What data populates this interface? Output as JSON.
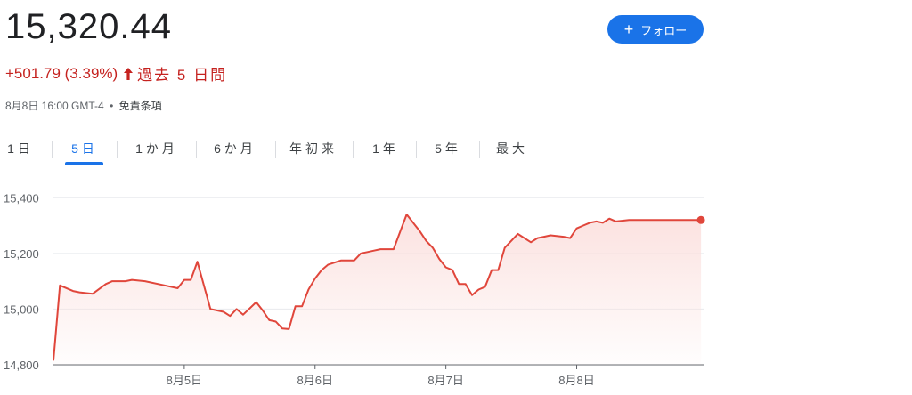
{
  "quote": {
    "price": "15,320.44",
    "change": "+501.79 (3.39%)",
    "period": "過去 5 日間",
    "timestamp": "8月8日 16:00 GMT-4",
    "separator": "•",
    "disclaimer": "免責条項"
  },
  "follow_button": {
    "icon": "plus-icon",
    "label": "フォロー"
  },
  "tabs": [
    {
      "label": "1日",
      "active": false
    },
    {
      "label": "5日",
      "active": true
    },
    {
      "label": "1か月",
      "active": false
    },
    {
      "label": "6か月",
      "active": false
    },
    {
      "label": "年初来",
      "active": false
    },
    {
      "label": "1年",
      "active": false
    },
    {
      "label": "5年",
      "active": false
    },
    {
      "label": "最大",
      "active": false
    }
  ],
  "colors": {
    "line": "#e0463b",
    "fill": "#fbe0de",
    "accent": "#1a73e8",
    "negative": "#c5221f"
  },
  "chart_data": {
    "type": "area",
    "ylim": [
      14800,
      15420
    ],
    "yticks": [
      14800,
      15000,
      15200,
      15400
    ],
    "ytick_labels": [
      "14,800",
      "15,000",
      "15,200",
      "15,400"
    ],
    "xlim": [
      0,
      4.97
    ],
    "xticks": [
      1,
      2,
      3,
      4
    ],
    "xtick_labels": [
      "8月5日",
      "8月6日",
      "8月7日",
      "8月8日"
    ],
    "grid": true,
    "series": [
      {
        "x": [
          0,
          0.05,
          0.15,
          0.2,
          0.3,
          0.4,
          0.45,
          0.55,
          0.6,
          0.7,
          0.85,
          0.95,
          1.0,
          1.05,
          1.1,
          1.2,
          1.3,
          1.35,
          1.4,
          1.45,
          1.55,
          1.6,
          1.65,
          1.7,
          1.75,
          1.8,
          1.85,
          1.9,
          1.95,
          2.0,
          2.05,
          2.1,
          2.2,
          2.3,
          2.35,
          2.4,
          2.45,
          2.5,
          2.55,
          2.6,
          2.7,
          2.8,
          2.85,
          2.9,
          2.95,
          3.0,
          3.05,
          3.1,
          3.15,
          3.2,
          3.25,
          3.3,
          3.35,
          3.4,
          3.45,
          3.55,
          3.65,
          3.7,
          3.75,
          3.8,
          3.9,
          3.95,
          4.0,
          4.05,
          4.1,
          4.15,
          4.2,
          4.25,
          4.3,
          4.4,
          4.5,
          4.55,
          4.6,
          4.7,
          4.8,
          4.85,
          4.9,
          4.95
        ],
        "y": [
          14815,
          15085,
          15065,
          15060,
          15055,
          15090,
          15100,
          15100,
          15105,
          15100,
          15085,
          15075,
          15105,
          15105,
          15170,
          15000,
          14990,
          14975,
          15000,
          14980,
          15025,
          14995,
          14960,
          14955,
          14930,
          14928,
          15010,
          15010,
          15070,
          15110,
          15140,
          15160,
          15175,
          15175,
          15200,
          15205,
          15210,
          15215,
          15215,
          15215,
          15340,
          15280,
          15245,
          15220,
          15180,
          15150,
          15140,
          15090,
          15090,
          15050,
          15070,
          15080,
          15140,
          15140,
          15220,
          15270,
          15240,
          15255,
          15260,
          15265,
          15260,
          15255,
          15290,
          15300,
          15310,
          15315,
          15310,
          15325,
          15315,
          15320,
          15320,
          15320,
          15320,
          15320,
          15320,
          15320,
          15320,
          15320
        ]
      }
    ]
  }
}
